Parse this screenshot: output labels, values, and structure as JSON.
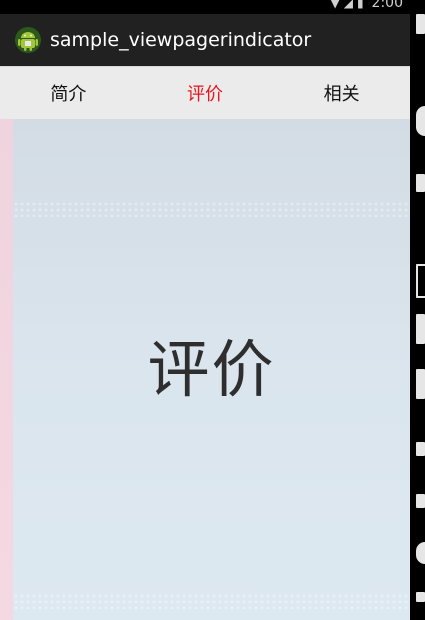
{
  "status_bar": {
    "time": "2:00",
    "icons": [
      "wifi-icon",
      "signal-icon",
      "battery-icon"
    ]
  },
  "action_bar": {
    "app_icon": "android-icon",
    "title": "sample_viewpagerindicator"
  },
  "tabs": [
    {
      "label": "简介",
      "active": false
    },
    {
      "label": "评价",
      "active": true
    },
    {
      "label": "相关",
      "active": false
    }
  ],
  "page": {
    "content": "评价"
  },
  "colors": {
    "action_bar_bg": "#212121",
    "tab_strip_bg": "#ebebeb",
    "active_tab": "#e8141e",
    "inactive_tab": "#111111",
    "page_bg": "#d3dce4",
    "adjacent_page_bg": "#efd3de"
  }
}
